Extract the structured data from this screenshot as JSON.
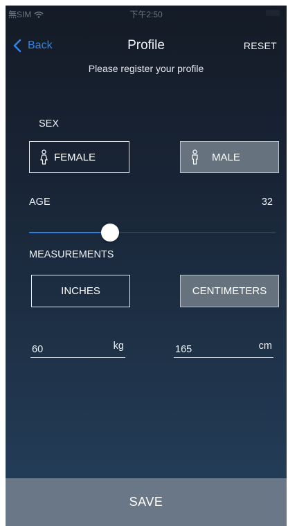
{
  "status_bar": {
    "carrier": "無SIM",
    "time": "下午2:50"
  },
  "nav": {
    "back_label": "Back",
    "title": "Profile",
    "reset_label": "RESET"
  },
  "subtitle": "Please register your profile",
  "sex": {
    "label": "SEX",
    "options": [
      {
        "label": "FEMALE",
        "selected": false
      },
      {
        "label": "MALE",
        "selected": true
      }
    ]
  },
  "age": {
    "label": "AGE",
    "value": "32",
    "slider_fraction": 0.33
  },
  "measurements": {
    "label": "MEASUREMENTS",
    "options": [
      {
        "label": "INCHES",
        "selected": false
      },
      {
        "label": "CENTIMETERS",
        "selected": true
      }
    ],
    "weight": {
      "value": "60",
      "unit": "kg"
    },
    "height": {
      "value": "165",
      "unit": "cm"
    }
  },
  "save_label": "SAVE",
  "colors": {
    "accent": "#2f84e6",
    "selected_button": "#66737f",
    "save_bar": "#6a7786"
  },
  "icons": [
    "chevron-left-icon",
    "person-female-icon",
    "person-male-icon",
    "wifi-icon",
    "battery-icon"
  ]
}
